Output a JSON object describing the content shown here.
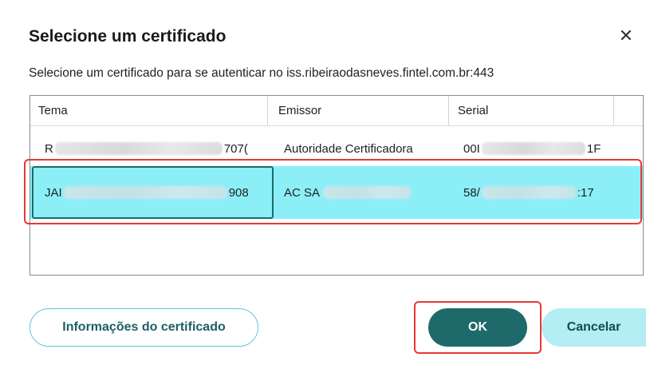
{
  "dialog": {
    "title": "Selecione um certificado",
    "close_icon": "close-icon",
    "subtitle": "Selecione um certificado para se autenticar no iss.ribeiraodasneves.fintel.com.br:443"
  },
  "table": {
    "headers": {
      "tema": "Tema",
      "emissor": "Emissor",
      "serial": "Serial"
    },
    "rows": [
      {
        "tema_start": "R",
        "tema_end": "707(",
        "emissor": "Autoridade Certificador⁠a",
        "serial_start": "00I",
        "serial_end": "1F"
      },
      {
        "tema_start": "JAI",
        "tema_end": "908",
        "emissor_start": "AC SA",
        "serial_start": "58/",
        "serial_end": ":17",
        "selected": true
      }
    ]
  },
  "buttons": {
    "info": "Informações do certificado",
    "ok": "OK",
    "cancel": "Cancelar"
  },
  "colors": {
    "selected_row": "#8ceff8",
    "primary": "#1e6a6a",
    "secondary": "#b3eef4",
    "highlight_red": "#e53935"
  }
}
